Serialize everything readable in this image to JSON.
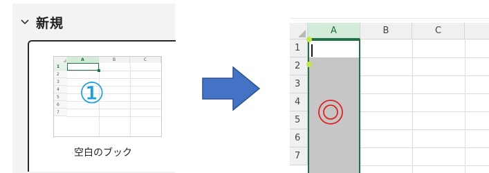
{
  "new_section": {
    "title": "新規",
    "chevron_icon": "chevron-down-icon"
  },
  "template_card": {
    "label": "空白のブック",
    "step_marker": "①",
    "thumbnail": {
      "columns": [
        "A",
        "B",
        "C"
      ],
      "rows": [
        "1",
        "2",
        "3",
        "4",
        "5",
        "6",
        "7"
      ],
      "selected_column": "A",
      "selected_row": "1"
    }
  },
  "arrow_icon": "right-arrow-icon",
  "spreadsheet": {
    "columns": [
      "A",
      "B",
      "C"
    ],
    "rows": [
      "1",
      "2",
      "3",
      "4",
      "5",
      "6",
      "7"
    ],
    "selected_column": "A",
    "active_cell": "A1",
    "selected_range": "A2:A7",
    "marker_icon": "double-circle-icon"
  },
  "colors": {
    "excel_green": "#217346",
    "step_marker_blue": "#18a0d8",
    "arrow_blue": "#4472c4",
    "marker_red": "#e02020",
    "selection_gray": "#c6c6c6",
    "handle_yellow_green": "#c4e64a"
  }
}
